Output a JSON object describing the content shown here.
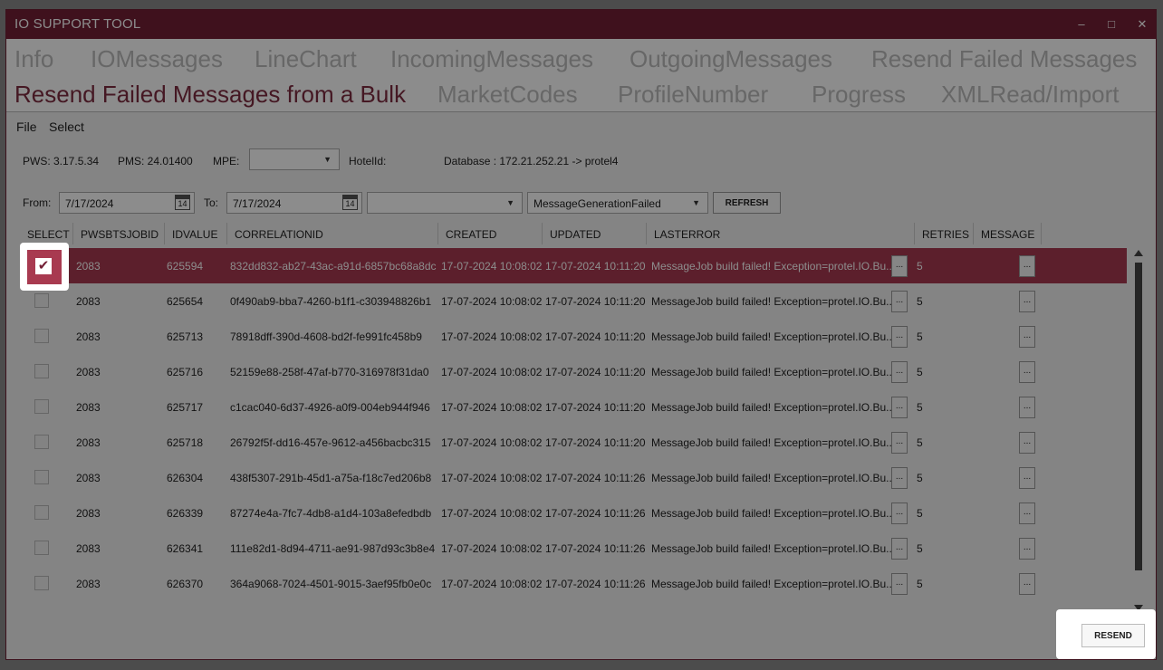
{
  "window": {
    "title": "IO SUPPORT TOOL",
    "minimize": "–",
    "maximize": "□",
    "close": "✕"
  },
  "tabs": [
    "Info",
    "IOMessages",
    "LineChart",
    "IncomingMessages",
    "OutgoingMessages",
    "Resend Failed Messages",
    "Resend Failed Messages from a Bulk",
    "MarketCodes",
    "ProfileNumber",
    "Progress",
    "XMLRead/Import"
  ],
  "active_tab": "Resend Failed Messages from a Bulk",
  "menu": {
    "file": "File",
    "select": "Select"
  },
  "info": {
    "pws": "PWS: 3.17.5.34",
    "pms": "PMS: 24.01400",
    "mpe_label": "MPE:",
    "mpe_value": "",
    "hotel_label": "HotelId:",
    "database": "Database : 172.21.252.21 -> protel4"
  },
  "filters": {
    "from_label": "From:",
    "from_value": "7/17/2024",
    "to_label": "To:",
    "to_value": "7/17/2024",
    "calendar_day": "14",
    "combo1_value": "",
    "status_value": "MessageGenerationFailed",
    "refresh": "REFRESH"
  },
  "columns": [
    "SELECT",
    "PWSBTSJOBID",
    "IDVALUE",
    "CORRELATIONID",
    "CREATED",
    "UPDATED",
    "LASTERROR",
    "RETRIES",
    "MESSAGE"
  ],
  "rows": [
    {
      "selected": true,
      "job": "2083",
      "id": "625594",
      "corr": "832dd832-ab27-43ac-a91d-6857bc68a8dc",
      "created": "17-07-2024 10:08:02",
      "updated": "17-07-2024 10:11:20",
      "error": "MessageJob build failed! Exception=protel.IO.Bu...",
      "retries": "5"
    },
    {
      "selected": false,
      "job": "2083",
      "id": "625654",
      "corr": "0f490ab9-bba7-4260-b1f1-c303948826b1",
      "created": "17-07-2024 10:08:02",
      "updated": "17-07-2024 10:11:20",
      "error": "MessageJob build failed! Exception=protel.IO.Bu...",
      "retries": "5"
    },
    {
      "selected": false,
      "job": "2083",
      "id": "625713",
      "corr": "78918dff-390d-4608-bd2f-fe991fc458b9",
      "created": "17-07-2024 10:08:02",
      "updated": "17-07-2024 10:11:20",
      "error": "MessageJob build failed! Exception=protel.IO.Bu...",
      "retries": "5"
    },
    {
      "selected": false,
      "job": "2083",
      "id": "625716",
      "corr": "52159e88-258f-47af-b770-316978f31da0",
      "created": "17-07-2024 10:08:02",
      "updated": "17-07-2024 10:11:20",
      "error": "MessageJob build failed! Exception=protel.IO.Bu...",
      "retries": "5"
    },
    {
      "selected": false,
      "job": "2083",
      "id": "625717",
      "corr": "c1cac040-6d37-4926-a0f9-004eb944f946",
      "created": "17-07-2024 10:08:02",
      "updated": "17-07-2024 10:11:20",
      "error": "MessageJob build failed! Exception=protel.IO.Bu...",
      "retries": "5"
    },
    {
      "selected": false,
      "job": "2083",
      "id": "625718",
      "corr": "26792f5f-dd16-457e-9612-a456bacbc315",
      "created": "17-07-2024 10:08:02",
      "updated": "17-07-2024 10:11:20",
      "error": "MessageJob build failed! Exception=protel.IO.Bu...",
      "retries": "5"
    },
    {
      "selected": false,
      "job": "2083",
      "id": "626304",
      "corr": "438f5307-291b-45d1-a75a-f18c7ed206b8",
      "created": "17-07-2024 10:08:02",
      "updated": "17-07-2024 10:11:26",
      "error": "MessageJob build failed! Exception=protel.IO.Bu...",
      "retries": "5"
    },
    {
      "selected": false,
      "job": "2083",
      "id": "626339",
      "corr": "87274e4a-7fc7-4db8-a1d4-103a8efedbdb",
      "created": "17-07-2024 10:08:02",
      "updated": "17-07-2024 10:11:26",
      "error": "MessageJob build failed! Exception=protel.IO.Bu...",
      "retries": "5"
    },
    {
      "selected": false,
      "job": "2083",
      "id": "626341",
      "corr": "111e82d1-8d94-4711-ae91-987d93c3b8e4",
      "created": "17-07-2024 10:08:02",
      "updated": "17-07-2024 10:11:26",
      "error": "MessageJob build failed! Exception=protel.IO.Bu...",
      "retries": "5"
    },
    {
      "selected": false,
      "job": "2083",
      "id": "626370",
      "corr": "364a9068-7024-4501-9015-3aef95fb0e0c",
      "created": "17-07-2024 10:08:02",
      "updated": "17-07-2024 10:11:26",
      "error": "MessageJob build failed! Exception=protel.IO.Bu...",
      "retries": "5"
    }
  ],
  "cell_button": "...",
  "resend": "RESEND",
  "colors": {
    "accent": "#731f35",
    "selected_row": "#a83a50"
  }
}
